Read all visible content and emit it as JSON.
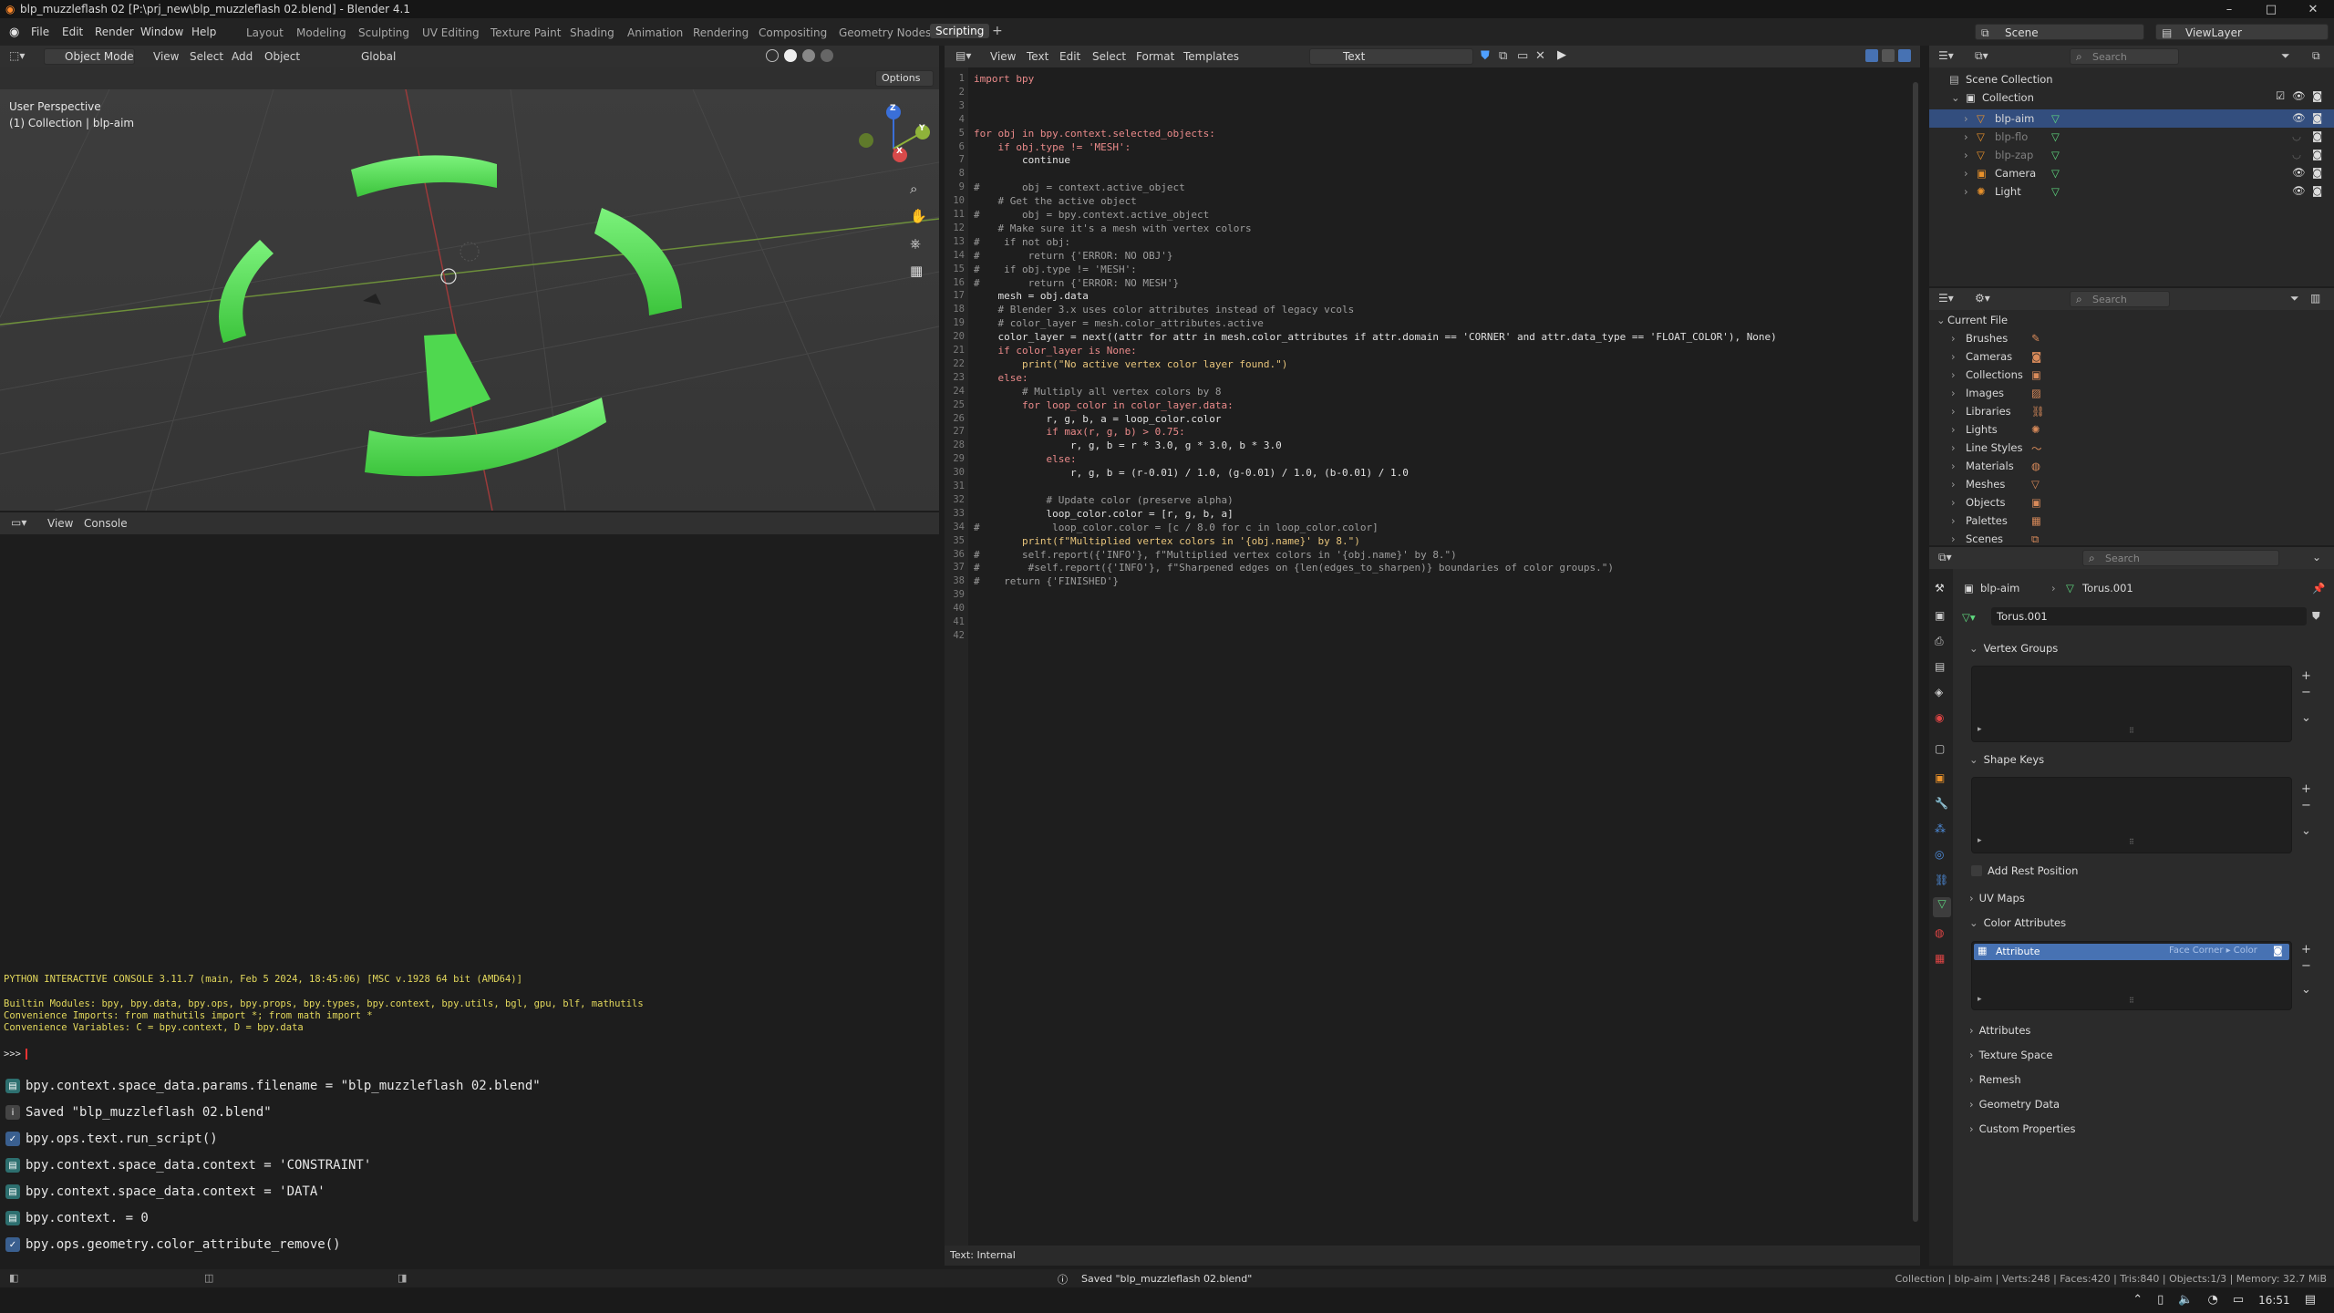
{
  "window": {
    "title": "blp_muzzleflash 02 [P:\\prj_new\\blp_muzzleflash 02.blend] - Blender 4.1",
    "controls": [
      "–",
      "□",
      "✕"
    ]
  },
  "menubar": {
    "items": [
      "File",
      "Edit",
      "Render",
      "Window",
      "Help"
    ],
    "workspaces": [
      "Layout",
      "Modeling",
      "Sculpting",
      "UV Editing",
      "Texture Paint",
      "Shading",
      "Animation",
      "Rendering",
      "Compositing",
      "Geometry Nodes",
      "Scripting"
    ],
    "active_workspace": "Scripting",
    "scene_label": "Scene",
    "viewlayer_label": "ViewLayer"
  },
  "viewport": {
    "mode": "Object Mode",
    "menus": [
      "View",
      "Select",
      "Add",
      "Object"
    ],
    "transform": "Global",
    "options_label": "Options",
    "perspective": "User Perspective",
    "collection_info": "(1) Collection | blp-aim",
    "axes": {
      "x": "X",
      "y": "Y",
      "z": "Z"
    }
  },
  "console": {
    "menus": [
      "View",
      "Console"
    ],
    "banner": "PYTHON INTERACTIVE CONSOLE 3.11.7 (main, Feb  5 2024, 18:45:06) [MSC v.1928 64 bit (AMD64)]",
    "builtin": "Builtin Modules:       bpy, bpy.data, bpy.ops, bpy.props, bpy.types, bpy.context, bpy.utils, bgl, gpu, blf, mathutils",
    "imports": "Convenience Imports:   from mathutils import *; from math import *",
    "variables": "Convenience Variables: C = bpy.context, D = bpy.data",
    "prompt": ">>> "
  },
  "info_log": [
    {
      "icon": "script",
      "text": "bpy.context.space_data.params.filename = \"blp_muzzleflash 02.blend\""
    },
    {
      "icon": "info",
      "text": "Saved \"blp_muzzleflash 02.blend\""
    },
    {
      "icon": "check",
      "text": "bpy.ops.text.run_script()"
    },
    {
      "icon": "script",
      "text": "bpy.context.space_data.context = 'CONSTRAINT'"
    },
    {
      "icon": "script",
      "text": "bpy.context.space_data.context = 'DATA'"
    },
    {
      "icon": "script",
      "text": "bpy.context. = 0"
    },
    {
      "icon": "check",
      "text": "bpy.ops.geometry.color_attribute_remove()"
    }
  ],
  "text_editor": {
    "menus": [
      "View",
      "Text",
      "Edit",
      "Select",
      "Format",
      "Templates"
    ],
    "datablock_name": "Text",
    "footer": "Text: Internal",
    "lines": [
      "import bpy",
      "",
      "",
      "",
      "for obj in bpy.context.selected_objects:",
      "    if obj.type != 'MESH':",
      "        continue",
      "",
      "#       obj = context.active_object",
      "    # Get the active object",
      "#       obj = bpy.context.active_object",
      "    # Make sure it's a mesh with vertex colors",
      "#    if not obj:",
      "#        return {'ERROR: NO OBJ'}",
      "#    if obj.type != 'MESH':",
      "#        return {'ERROR: NO MESH'}",
      "    mesh = obj.data",
      "    # Blender 3.x uses color attributes instead of legacy vcols",
      "    # color_layer = mesh.color_attributes.active",
      "    color_layer = next((attr for attr in mesh.color_attributes if attr.domain == 'CORNER' and attr.data_type == 'FLOAT_COLOR'), None)",
      "    if color_layer is None:",
      "        print(\"No active vertex color layer found.\")",
      "    else:",
      "        # Multiply all vertex colors by 8",
      "        for loop_color in color_layer.data:",
      "            r, g, b, a = loop_color.color",
      "            if max(r, g, b) > 0.75:",
      "                r, g, b = r * 3.0, g * 3.0, b * 3.0",
      "            else:",
      "                r, g, b = (r-0.01) / 1.0, (g-0.01) / 1.0, (b-0.01) / 1.0",
      "",
      "            # Update color (preserve alpha)",
      "            loop_color.color = [r, g, b, a]",
      "#            loop_color.color = [c / 8.0 for c in loop_color.color]",
      "        print(f\"Multiplied vertex colors in '{obj.name}' by 8.\")",
      "#       self.report({'INFO'}, f\"Multiplied vertex colors in '{obj.name}' by 8.\")",
      "#        #self.report({'INFO'}, f\"Sharpened edges on {len(edges_to_sharpen)} boundaries of color groups.\")",
      "#    return {'FINISHED'}",
      "",
      "",
      "",
      ""
    ]
  },
  "outliner": {
    "search_placeholder": "Search",
    "root": "Scene Collection",
    "collection": "Collection",
    "items": [
      {
        "name": "blp-aim",
        "selected": true,
        "visible": true
      },
      {
        "name": "blp-flo",
        "selected": false,
        "visible": false
      },
      {
        "name": "blp-zap",
        "selected": false,
        "visible": false
      },
      {
        "name": "Camera",
        "selected": false,
        "visible": true
      },
      {
        "name": "Light",
        "selected": false,
        "visible": true
      }
    ]
  },
  "file_browser": {
    "search_placeholder": "Search",
    "root": "Current File",
    "items": [
      "Brushes",
      "Cameras",
      "Collections",
      "Images",
      "Libraries",
      "Lights",
      "Line Styles",
      "Materials",
      "Meshes",
      "Objects",
      "Palettes",
      "Scenes"
    ]
  },
  "properties": {
    "search_placeholder": "Search",
    "breadcrumb_object": "blp-aim",
    "breadcrumb_mesh": "Torus.001",
    "mesh_name": "Torus.001",
    "sections": {
      "vertex_groups": "Vertex Groups",
      "shape_keys": "Shape Keys",
      "add_rest_position": "Add Rest Position",
      "uv_maps": "UV Maps",
      "color_attributes": "Color Attributes",
      "attributes": "Attributes",
      "texture_space": "Texture Space",
      "remesh": "Remesh",
      "geometry_data": "Geometry Data",
      "custom_properties": "Custom Properties"
    },
    "color_attribute": {
      "name": "Attribute",
      "domain": "Face Corner ▸ Color"
    }
  },
  "statusbar": {
    "message": "Saved \"blp_muzzleflash 02.blend\"",
    "stats": "Collection | blp-aim | Verts:248 | Faces:420 | Tris:840 | Objects:1/3 | Memory: 32.7 MiB"
  },
  "taskbar": {
    "time": "16:51"
  },
  "colors": {
    "accent": "#4772b3",
    "mesh_green": "#5ee85e",
    "selected_row": "#334e7e"
  }
}
